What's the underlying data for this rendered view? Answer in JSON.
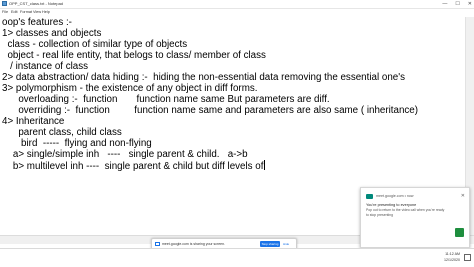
{
  "window": {
    "title": "OPP_CST_class.txt - Notepad",
    "controls": [
      "—",
      "☐",
      "✕"
    ]
  },
  "menu": [
    "File",
    "Edit",
    "Format",
    "View",
    "Help"
  ],
  "editor": {
    "lines": [
      "oop's features :-",
      "1> classes and objects",
      "  class - collection of similar type of objects",
      "  object - real life entity, that belogs to class/ member of class",
      "   / instance of class",
      "2> data abstraction/ data hiding :-  hiding the non-essential data removing the essential one's",
      "3> polymorphism - the existence of any object in diff forms.",
      "      overloading :-  function       function name same But parameters are diff.",
      "      overriding :-  function         function name same and parameters are also same ( inheritance)",
      "4> Inheritance",
      "      parent class, child class",
      "       bird  -----  flying and non-flying",
      "    a> single/simple inh   ----   single parent & child.   a->b",
      "    b> multilevel inh ----  single parent & child but diff levels of"
    ]
  },
  "share_bar": {
    "text": "meet.google.com is sharing your screen.",
    "stop_label": "Stop sharing",
    "hide_label": "Hide"
  },
  "notification": {
    "source": "meet.google.com • now",
    "title": "You're presenting to everyone",
    "body": "Pop out to return to the video call when you're ready to stop presenting",
    "close": "✕"
  },
  "taskbar": {
    "time": "11:12 AM",
    "date": "12/1/2020"
  }
}
